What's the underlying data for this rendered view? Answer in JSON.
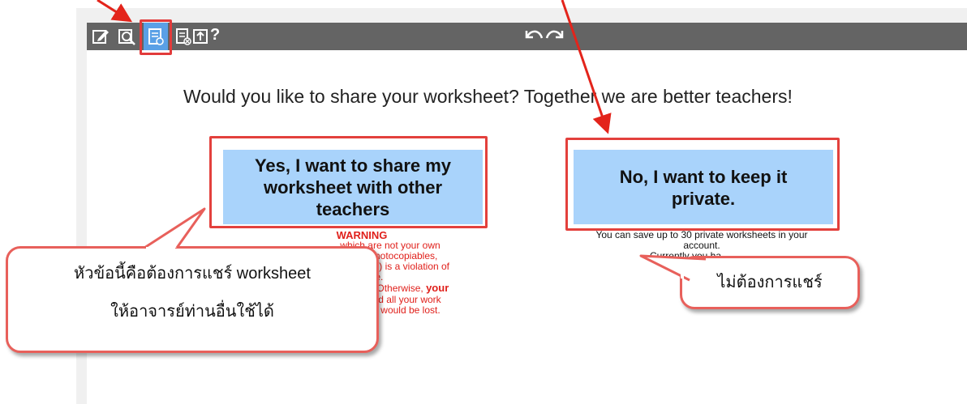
{
  "toolbar": {
    "icons": [
      "edit-icon",
      "preview-icon",
      "share-icon",
      "unshare-icon",
      "export-icon",
      "help-icon",
      "undo-icon",
      "redo-icon"
    ],
    "help_label": "?"
  },
  "main": {
    "question": "Would you like to share your worksheet? Together we are better teachers!",
    "share_button": {
      "label_lines": [
        "Yes, I want to share my",
        "worksheet with other",
        "teachers"
      ]
    },
    "keep_button": {
      "label_lines": [
        "No, I want to keep it",
        "private."
      ]
    },
    "warning": {
      "title": "WARNING",
      "line1": "which are not your own",
      "line2": "s, photocopiables,",
      "line3": "etc.) is a violation of",
      "line4": "use.",
      "line5_pre": "ate'. Otherwise, ",
      "line5_bold": "your",
      "line6_bold": "d",
      "line6_rest": ", and all your work",
      "line7": "would be lost."
    },
    "private_note": {
      "line1": "You can save up to 30 private worksheets in your",
      "line2": "account.",
      "line3": "Currently you ha"
    }
  },
  "callouts": {
    "left_line1": "หัวข้อนี้คือต้องการแชร์ worksheet",
    "left_line2": "ให้อาจารย์ท่านอื่นใช้ได้",
    "right": "ไม่ต้องการแชร์"
  },
  "colors": {
    "toolbar": "#646464",
    "button": "#a9d3fb",
    "annotation": "#e3403c",
    "warning_text": "#e0201b"
  }
}
